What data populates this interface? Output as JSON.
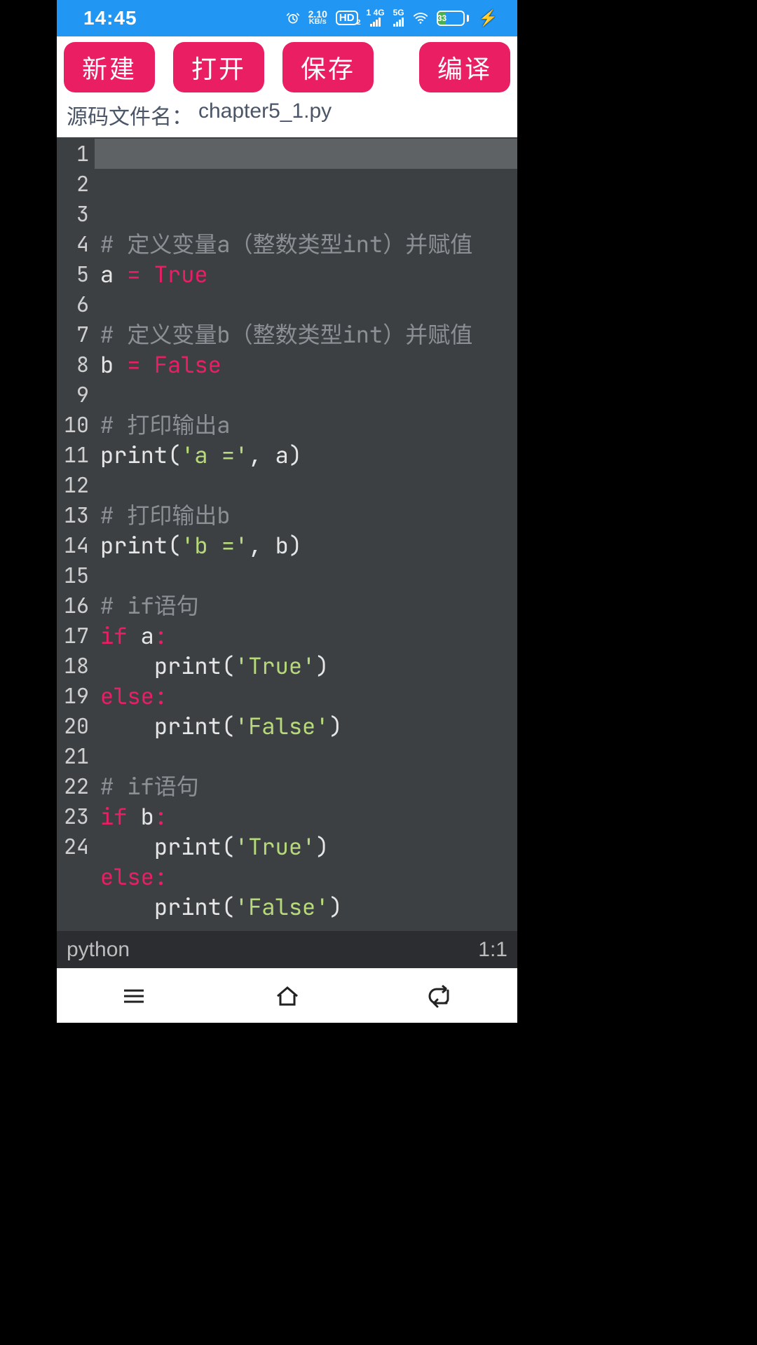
{
  "status": {
    "time": "14:45",
    "net_speed_top": "2.10",
    "net_speed_bot": "KB/s",
    "hd_label": "HD",
    "hd_sub": "2",
    "sig1_top": "1",
    "sig1_g": "4G",
    "sig2_g": "5G",
    "battery_pct": "33"
  },
  "toolbar": {
    "new": "新建",
    "open": "打开",
    "save": "保存",
    "compile": "编译"
  },
  "file": {
    "label": "源码文件名：",
    "name": "chapter5_1.py"
  },
  "code": {
    "lines": [
      [
        {
          "cls": "tok-cm",
          "t": "# 定义变量a（整数类型int）并赋值"
        }
      ],
      [
        {
          "cls": "tok-id",
          "t": "a "
        },
        {
          "cls": "tok-op",
          "t": "="
        },
        {
          "cls": "tok-id",
          "t": " "
        },
        {
          "cls": "tok-bool",
          "t": "True"
        }
      ],
      [],
      [
        {
          "cls": "tok-cm",
          "t": "# 定义变量b（整数类型int）并赋值"
        }
      ],
      [
        {
          "cls": "tok-id",
          "t": "b "
        },
        {
          "cls": "tok-op",
          "t": "="
        },
        {
          "cls": "tok-id",
          "t": " "
        },
        {
          "cls": "tok-bool",
          "t": "False"
        }
      ],
      [],
      [
        {
          "cls": "tok-cm",
          "t": "# 打印输出a"
        }
      ],
      [
        {
          "cls": "tok-fn",
          "t": "print"
        },
        {
          "cls": "tok-punc",
          "t": "("
        },
        {
          "cls": "tok-str",
          "t": "'a ='"
        },
        {
          "cls": "tok-punc",
          "t": ", "
        },
        {
          "cls": "tok-id",
          "t": "a"
        },
        {
          "cls": "tok-punc",
          "t": ")"
        }
      ],
      [],
      [
        {
          "cls": "tok-cm",
          "t": "# 打印输出b"
        }
      ],
      [
        {
          "cls": "tok-fn",
          "t": "print"
        },
        {
          "cls": "tok-punc",
          "t": "("
        },
        {
          "cls": "tok-str",
          "t": "'b ='"
        },
        {
          "cls": "tok-punc",
          "t": ", "
        },
        {
          "cls": "tok-id",
          "t": "b"
        },
        {
          "cls": "tok-punc",
          "t": ")"
        }
      ],
      [],
      [
        {
          "cls": "tok-cm",
          "t": "# if语句"
        }
      ],
      [
        {
          "cls": "tok-kw",
          "t": "if"
        },
        {
          "cls": "tok-id",
          "t": " a"
        },
        {
          "cls": "tok-op",
          "t": ":"
        }
      ],
      [
        {
          "cls": "tok-id",
          "t": "    "
        },
        {
          "cls": "tok-fn",
          "t": "print"
        },
        {
          "cls": "tok-punc",
          "t": "("
        },
        {
          "cls": "tok-str",
          "t": "'True'"
        },
        {
          "cls": "tok-punc",
          "t": ")"
        }
      ],
      [
        {
          "cls": "tok-kw",
          "t": "else"
        },
        {
          "cls": "tok-op",
          "t": ":"
        }
      ],
      [
        {
          "cls": "tok-id",
          "t": "    "
        },
        {
          "cls": "tok-fn",
          "t": "print"
        },
        {
          "cls": "tok-punc",
          "t": "("
        },
        {
          "cls": "tok-str",
          "t": "'False'"
        },
        {
          "cls": "tok-punc",
          "t": ")"
        }
      ],
      [],
      [
        {
          "cls": "tok-cm",
          "t": "# if语句"
        }
      ],
      [
        {
          "cls": "tok-kw",
          "t": "if"
        },
        {
          "cls": "tok-id",
          "t": " b"
        },
        {
          "cls": "tok-op",
          "t": ":"
        }
      ],
      [
        {
          "cls": "tok-id",
          "t": "    "
        },
        {
          "cls": "tok-fn",
          "t": "print"
        },
        {
          "cls": "tok-punc",
          "t": "("
        },
        {
          "cls": "tok-str",
          "t": "'True'"
        },
        {
          "cls": "tok-punc",
          "t": ")"
        }
      ],
      [
        {
          "cls": "tok-kw",
          "t": "else"
        },
        {
          "cls": "tok-op",
          "t": ":"
        }
      ],
      [
        {
          "cls": "tok-id",
          "t": "    "
        },
        {
          "cls": "tok-fn",
          "t": "print"
        },
        {
          "cls": "tok-punc",
          "t": "("
        },
        {
          "cls": "tok-str",
          "t": "'False'"
        },
        {
          "cls": "tok-punc",
          "t": ")"
        }
      ],
      []
    ],
    "highlight_line": 1
  },
  "editor_status": {
    "lang": "python",
    "pos": "1:1"
  }
}
